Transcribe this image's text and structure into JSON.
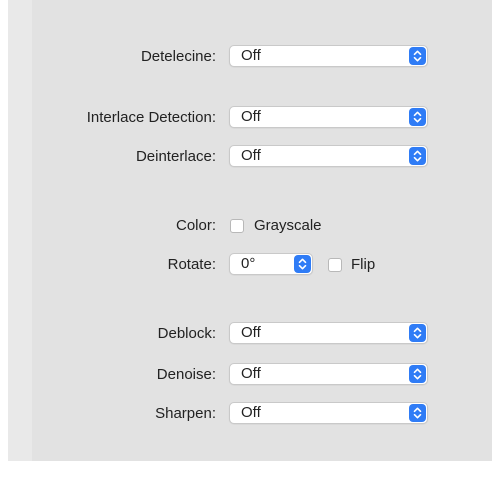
{
  "filters": {
    "detelecine": {
      "label": "Detelecine:",
      "value": "Off"
    },
    "interlace_detection": {
      "label": "Interlace Detection:",
      "value": "Off"
    },
    "deinterlace": {
      "label": "Deinterlace:",
      "value": "Off"
    },
    "color": {
      "label": "Color:",
      "checkbox_label": "Grayscale",
      "checked": false
    },
    "rotate": {
      "label": "Rotate:",
      "value": "0°",
      "flip_label": "Flip",
      "flip_checked": false
    },
    "deblock": {
      "label": "Deblock:",
      "value": "Off"
    },
    "denoise": {
      "label": "Denoise:",
      "value": "Off"
    },
    "sharpen": {
      "label": "Sharpen:",
      "value": "Off"
    }
  },
  "colors": {
    "accent": "#2f7cf6",
    "panel_background": "#e2e2e2"
  },
  "icons": {
    "popup_stepper": "chevron-up-down-icon"
  }
}
